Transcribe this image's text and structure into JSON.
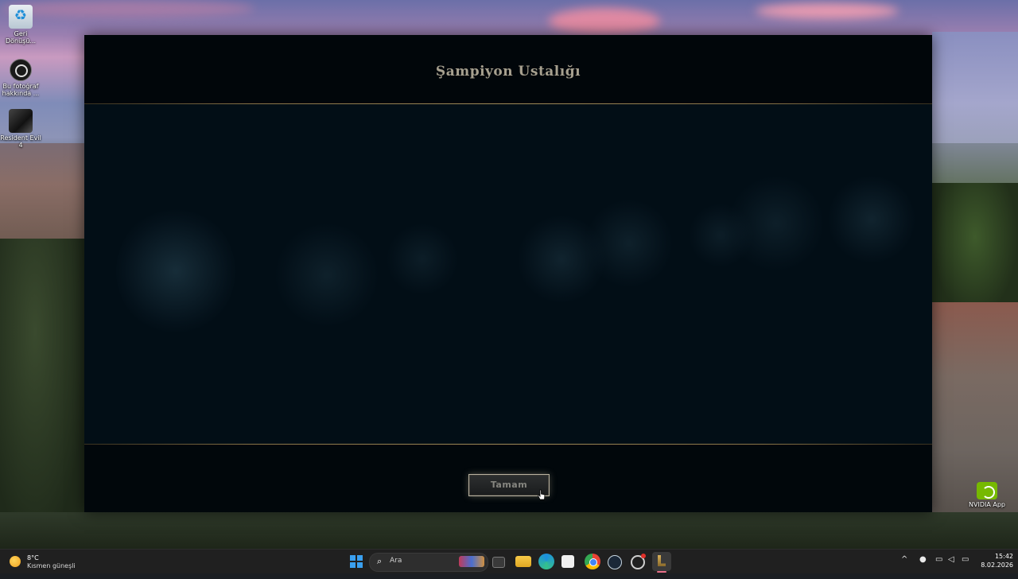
{
  "desktop": {
    "icons": [
      {
        "label": "Geri Dönüşü..."
      },
      {
        "label": "Bu fotoğraf hakkında ..."
      },
      {
        "label": "Resident Evil 4"
      },
      {
        "label": "NVIDIA App"
      }
    ]
  },
  "dialog": {
    "title": "Şampiyon Ustalığı",
    "ok_button": "Tamam"
  },
  "taskbar": {
    "weather": {
      "temperature": "8°C",
      "condition": "Kısmen güneşli"
    },
    "search_placeholder": "Ara",
    "clock": {
      "time": "15:42",
      "date": "8.02.2026"
    }
  }
}
